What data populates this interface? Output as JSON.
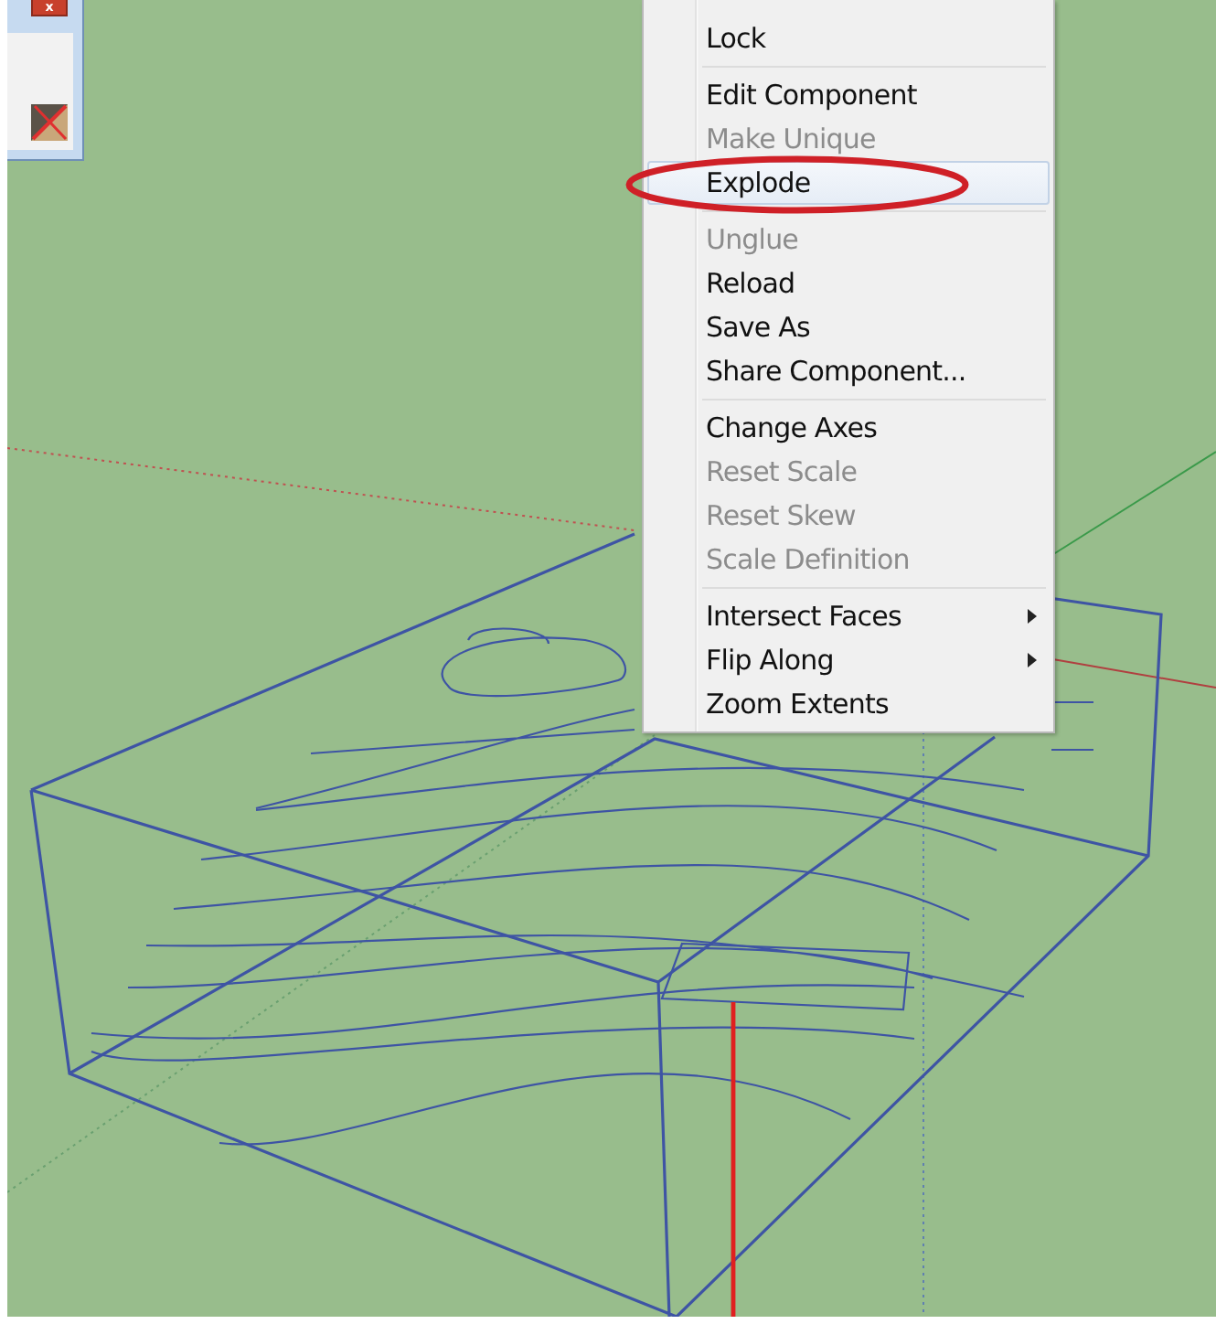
{
  "toolbar": {
    "close_button": "x"
  },
  "context_menu": {
    "groups": [
      [
        {
          "label": "Lock",
          "disabled": false,
          "selected": false,
          "submenu": false,
          "circled": false
        }
      ],
      [
        {
          "label": "Edit Component",
          "disabled": false,
          "selected": false,
          "submenu": false,
          "circled": false
        },
        {
          "label": "Make Unique",
          "disabled": true,
          "selected": false,
          "submenu": false,
          "circled": false
        },
        {
          "label": "Explode",
          "disabled": false,
          "selected": true,
          "submenu": false,
          "circled": true
        }
      ],
      [
        {
          "label": "Unglue",
          "disabled": true,
          "selected": false,
          "submenu": false,
          "circled": false
        },
        {
          "label": "Reload",
          "disabled": false,
          "selected": false,
          "submenu": false,
          "circled": false
        },
        {
          "label": "Save As",
          "disabled": false,
          "selected": false,
          "submenu": false,
          "circled": false
        },
        {
          "label": "Share Component...",
          "disabled": false,
          "selected": false,
          "submenu": false,
          "circled": false
        }
      ],
      [
        {
          "label": "Change Axes",
          "disabled": false,
          "selected": false,
          "submenu": false,
          "circled": false
        },
        {
          "label": "Reset Scale",
          "disabled": true,
          "selected": false,
          "submenu": false,
          "circled": false
        },
        {
          "label": "Reset Skew",
          "disabled": true,
          "selected": false,
          "submenu": false,
          "circled": false
        },
        {
          "label": "Scale Definition",
          "disabled": true,
          "selected": false,
          "submenu": false,
          "circled": false
        }
      ],
      [
        {
          "label": "Intersect Faces",
          "disabled": false,
          "selected": false,
          "submenu": true,
          "circled": false
        },
        {
          "label": "Flip Along",
          "disabled": false,
          "selected": false,
          "submenu": true,
          "circled": false
        },
        {
          "label": "Zoom Extents",
          "disabled": false,
          "selected": false,
          "submenu": false,
          "circled": false
        }
      ]
    ]
  }
}
